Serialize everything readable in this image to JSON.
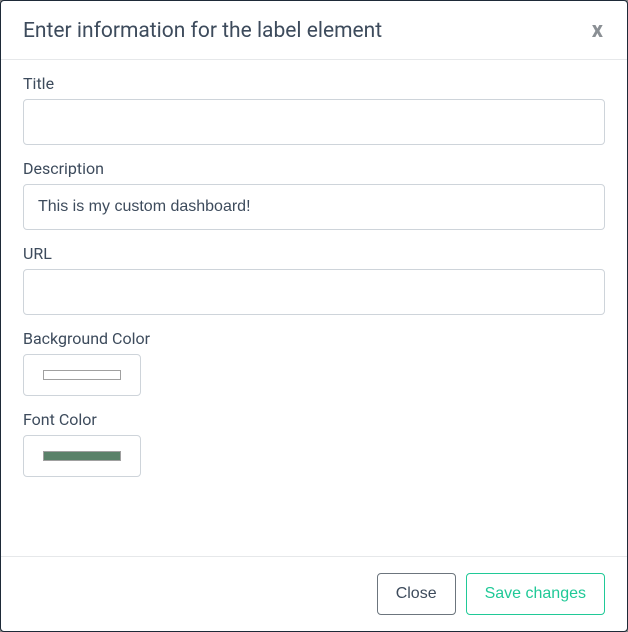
{
  "modal": {
    "title": "Enter information for the label element",
    "close_glyph": "x"
  },
  "form": {
    "title_label": "Title",
    "title_value": "",
    "description_label": "Description",
    "description_value": "This is my custom dashboard!",
    "url_label": "URL",
    "url_value": "",
    "bgcolor_label": "Background Color",
    "bgcolor_value": "#ffffff",
    "fontcolor_label": "Font Color",
    "fontcolor_value": "#5a8169"
  },
  "footer": {
    "close_label": "Close",
    "save_label": "Save changes"
  }
}
